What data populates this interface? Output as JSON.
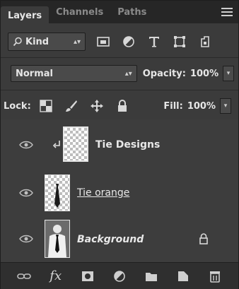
{
  "tabs": [
    {
      "label": "Layers",
      "active": true
    },
    {
      "label": "Channels",
      "active": false
    },
    {
      "label": "Paths",
      "active": false
    }
  ],
  "filter": {
    "kind_label": "Kind",
    "icons": [
      "image-filter-icon",
      "adjustment-filter-icon",
      "type-filter-icon",
      "shape-filter-icon",
      "smart-object-filter-icon"
    ]
  },
  "blend": {
    "mode": "Normal",
    "opacity_label": "Opacity:",
    "opacity_value": "100%"
  },
  "lock": {
    "label": "Lock:",
    "fill_label": "Fill:",
    "fill_value": "100%"
  },
  "layers": [
    {
      "name": "Tie Designs",
      "bold": true,
      "underline": false,
      "italic": false,
      "clipped": true,
      "locked": false
    },
    {
      "name": "Tie orange",
      "bold": false,
      "underline": true,
      "italic": false,
      "clipped": false,
      "locked": false
    },
    {
      "name": "Background",
      "bold": false,
      "underline": false,
      "italic": true,
      "clipped": false,
      "locked": true
    }
  ],
  "colors": {
    "panel_bg": "#3b3b3b",
    "tab_bar_bg": "#262626",
    "text": "#e6e6e6"
  }
}
